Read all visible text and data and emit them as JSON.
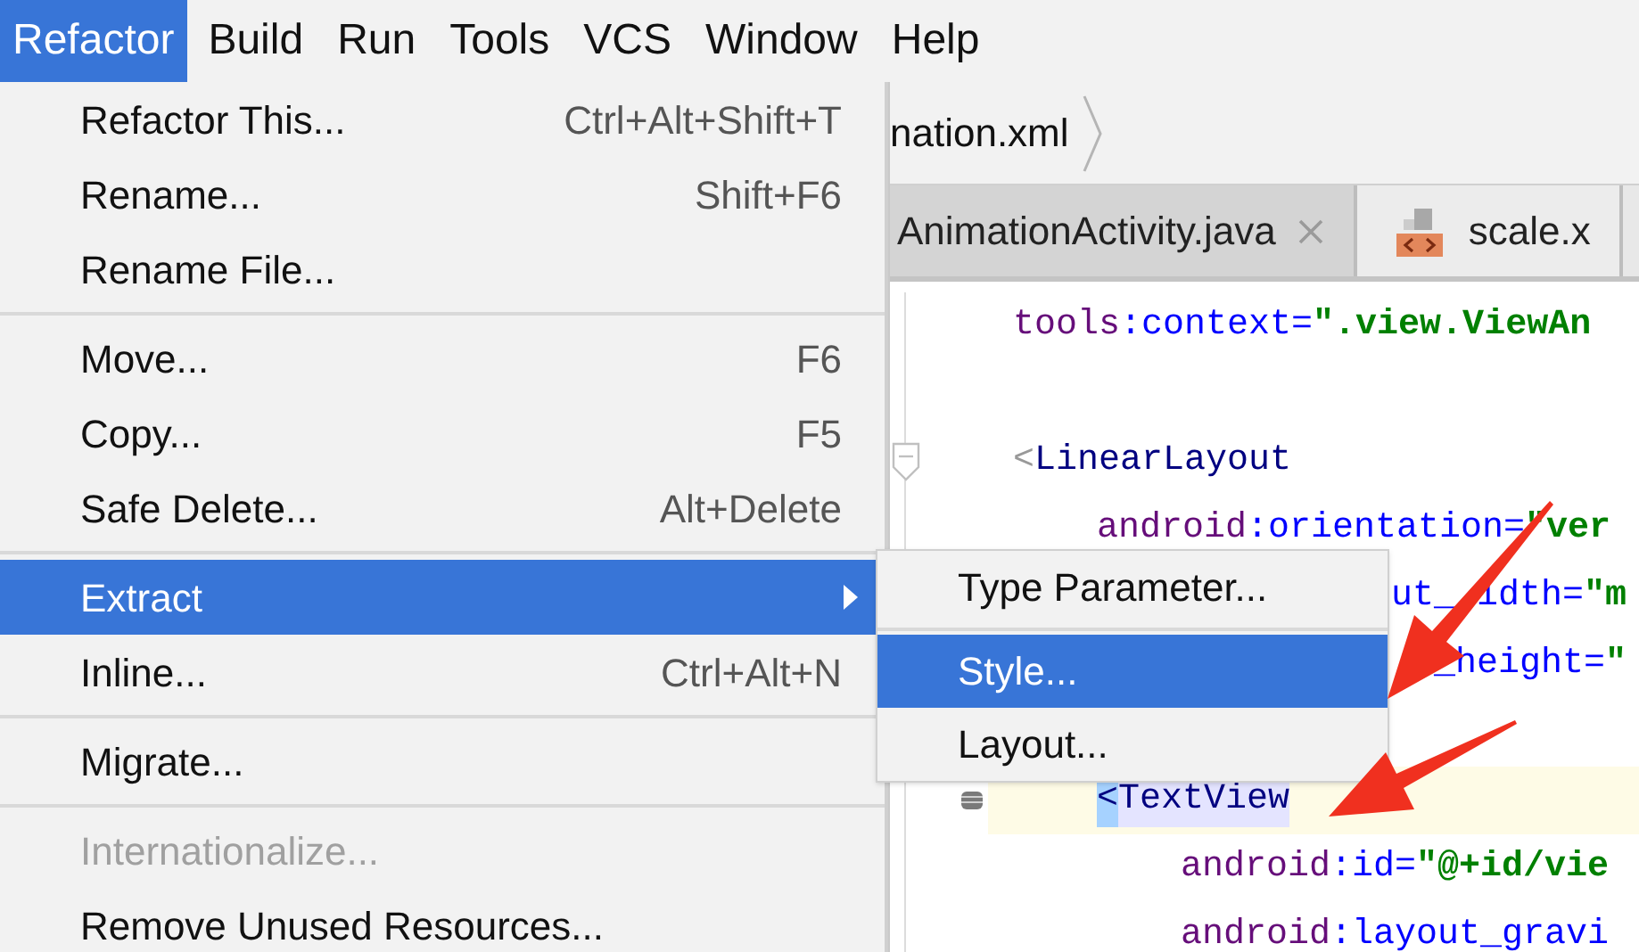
{
  "menubar": [
    {
      "label": "Refactor",
      "selected": true
    },
    {
      "label": "Build",
      "selected": false
    },
    {
      "label": "Run",
      "selected": false
    },
    {
      "label": "Tools",
      "selected": false
    },
    {
      "label": "VCS",
      "selected": false
    },
    {
      "label": "Window",
      "selected": false
    },
    {
      "label": "Help",
      "selected": false
    }
  ],
  "breadcrumb": {
    "label": "nation.xml"
  },
  "tabs": [
    {
      "kind": "plain",
      "label": "AnimationActivity.java",
      "selected": true,
      "closable": true
    },
    {
      "kind": "xml",
      "label": "scale.x",
      "selected": false,
      "closable": false
    }
  ],
  "code": [
    {
      "kind": "line",
      "parts": [
        {
          "text": "tools",
          "kind": "ns"
        },
        {
          "text": ":context=",
          "kind": "attr"
        },
        {
          "text": "\".view.ViewAn",
          "kind": "value"
        }
      ]
    },
    {
      "kind": "blank"
    },
    {
      "kind": "line",
      "parts": [
        {
          "text": "<",
          "kind": "bracket"
        },
        {
          "text": "LinearLayout",
          "kind": "tag"
        }
      ],
      "children": [
        {
          "kind": "line",
          "parts": [
            {
              "text": "android",
              "kind": "ns"
            },
            {
              "text": ":orientation=",
              "kind": "attr"
            },
            {
              "text": "\"ver",
              "kind": "value"
            }
          ]
        },
        {
          "kind": "line",
          "covered": true,
          "parts": [
            {
              "text": "ut_",
              "kind": "attr"
            },
            {
              "kind": "gap"
            },
            {
              "text": "idth=",
              "kind": "attr"
            },
            {
              "text": "\"m",
              "kind": "value"
            }
          ]
        },
        {
          "kind": "line",
          "covered": true,
          "parts": [
            {
              "kind": "gap"
            },
            {
              "kind": "gap"
            },
            {
              "text": "_height=",
              "kind": "attr"
            },
            {
              "text": "\"",
              "kind": "value"
            }
          ]
        },
        {
          "kind": "blank"
        },
        {
          "kind": "line",
          "highlighted": true,
          "parts": [
            {
              "text": "<",
              "kind": "match"
            },
            {
              "text": "TextView",
              "kind": "tagmatch"
            }
          ],
          "children": [
            {
              "kind": "line",
              "parts": [
                {
                  "text": "android",
                  "kind": "ns"
                },
                {
                  "text": ":id=",
                  "kind": "attr"
                },
                {
                  "text": "\"@+id/vie",
                  "kind": "value"
                }
              ]
            },
            {
              "kind": "line",
              "parts": [
                {
                  "text": "android",
                  "kind": "ns"
                },
                {
                  "text": ":layout_gravi",
                  "kind": "attr"
                }
              ]
            }
          ]
        }
      ]
    }
  ],
  "menu": [
    {
      "kind": "item",
      "label": "Refactor This...",
      "shortcut": "Ctrl+Alt+Shift+T",
      "selected": false,
      "disabled": false
    },
    {
      "kind": "item",
      "label": "Rename...",
      "shortcut": "Shift+F6",
      "selected": false,
      "disabled": false
    },
    {
      "kind": "item",
      "label": "Rename File...",
      "selected": false,
      "disabled": false
    },
    {
      "kind": "separator"
    },
    {
      "kind": "item",
      "label": "Move...",
      "shortcut": "F6",
      "selected": false,
      "disabled": false
    },
    {
      "kind": "item",
      "label": "Copy...",
      "shortcut": "F5",
      "selected": false,
      "disabled": false
    },
    {
      "kind": "item",
      "label": "Safe Delete...",
      "shortcut": "Alt+Delete",
      "selected": false,
      "disabled": false
    },
    {
      "kind": "separator"
    },
    {
      "kind": "submenu",
      "label": "Extract",
      "selected": true,
      "disabled": false
    },
    {
      "kind": "item",
      "label": "Inline...",
      "shortcut": "Ctrl+Alt+N",
      "selected": false,
      "disabled": false
    },
    {
      "kind": "separator"
    },
    {
      "kind": "item",
      "label": "Migrate...",
      "selected": false,
      "disabled": false
    },
    {
      "kind": "separator"
    },
    {
      "kind": "item",
      "label": "Internationalize...",
      "selected": false,
      "disabled": true
    },
    {
      "kind": "item",
      "label": "Remove Unused Resources...",
      "selected": false,
      "disabled": false
    }
  ],
  "submenu": [
    {
      "kind": "item",
      "label": "Type Parameter...",
      "selected": false,
      "disabled": false
    },
    {
      "kind": "separator"
    },
    {
      "kind": "item",
      "label": "Style...",
      "selected": true,
      "disabled": false
    },
    {
      "kind": "item",
      "label": "Layout...",
      "selected": false,
      "disabled": false
    }
  ]
}
